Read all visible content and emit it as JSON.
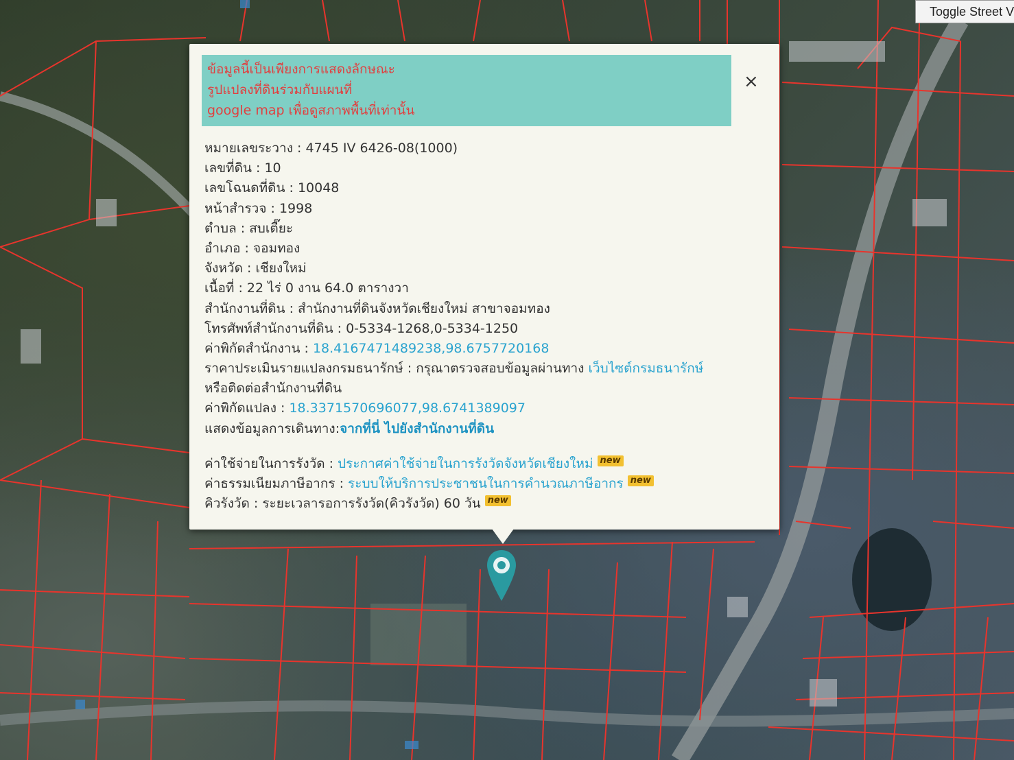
{
  "toggle_label": "Toggle Street Vi",
  "notice_lines": [
    "ข้อมูลนี้เป็นเพียงการแสดงลักษณะ",
    "รูปแปลงที่ดินร่วมกับแผนที่",
    "google map เพื่อดูสภาพพื้นที่เท่านั้น"
  ],
  "close_symbol": "×",
  "fields": {
    "map_sheet": {
      "label": "หมายเลขระวาง :",
      "value": "4745 IV 6426-08(1000)"
    },
    "parcel_no": {
      "label": "เลขที่ดิน :",
      "value": "10"
    },
    "deed_no": {
      "label": "เลขโฉนดที่ดิน :",
      "value": "10048"
    },
    "survey_page": {
      "label": "หน้าสำรวจ :",
      "value": "1998"
    },
    "subdistrict": {
      "label": "ตำบล :",
      "value": "สบเตี๊ยะ"
    },
    "district": {
      "label": "อำเภอ :",
      "value": "จอมทอง"
    },
    "province": {
      "label": "จังหวัด :",
      "value": "เชียงใหม่"
    },
    "area": {
      "label": "เนื้อที่ :",
      "value": "22 ไร่ 0 งาน 64.0 ตารางวา"
    },
    "land_office": {
      "label": "สำนักงานที่ดิน :",
      "value": "สำนักงานที่ดินจังหวัดเชียงใหม่ สาขาจอมทอง"
    },
    "office_phone": {
      "label": "โทรศัพท์สำนักงานที่ดิน :",
      "value": "0-5334-1268,0-5334-1250"
    },
    "office_coords": {
      "label": "ค่าพิกัดสำนักงาน :",
      "value": "18.4167471489238,98.6757720168"
    },
    "appraisal": {
      "label": "ราคาประเมินรายแปลงกรมธนารักษ์ :",
      "value": "กรุณาตรวจสอบข้อมูลผ่านทาง",
      "link": "เว็บไซต์กรมธนารักษ์",
      "line2": "หรือติดต่อสำนักงานที่ดิน"
    },
    "parcel_coords": {
      "label": "ค่าพิกัดแปลง :",
      "value": "18.3371570696077,98.6741389097"
    },
    "directions": {
      "label": "แสดงข้อมูลการเดินทาง:",
      "link": "จากที่นี่ ไปยังสำนักงานที่ดิน"
    },
    "survey_cost": {
      "label": "ค่าใช้จ่ายในการรังวัด :",
      "link": "ประกาศค่าใช้จ่ายในการรังวัดจังหวัดเชียงใหม่"
    },
    "tax_fee": {
      "label": "ค่าธรรมเนียมภาษีอากร :",
      "link": "ระบบให้บริการประชาชนในการคำนวณภาษีอากร"
    },
    "survey_queue": {
      "label": "คิวรังวัด :",
      "value": "ระยะเวลารอการรังวัด(คิวรังวัด) 60 วัน"
    }
  },
  "new_badge": "new",
  "colors": {
    "parcel_line": "#e8342c",
    "notice_bg": "#7fcfc5",
    "notice_text": "#e04040",
    "link": "#2aa3cf",
    "marker": "#2a9aa0",
    "badge": "#f2c030"
  },
  "icons": [
    "close-icon",
    "map-marker-icon"
  ]
}
